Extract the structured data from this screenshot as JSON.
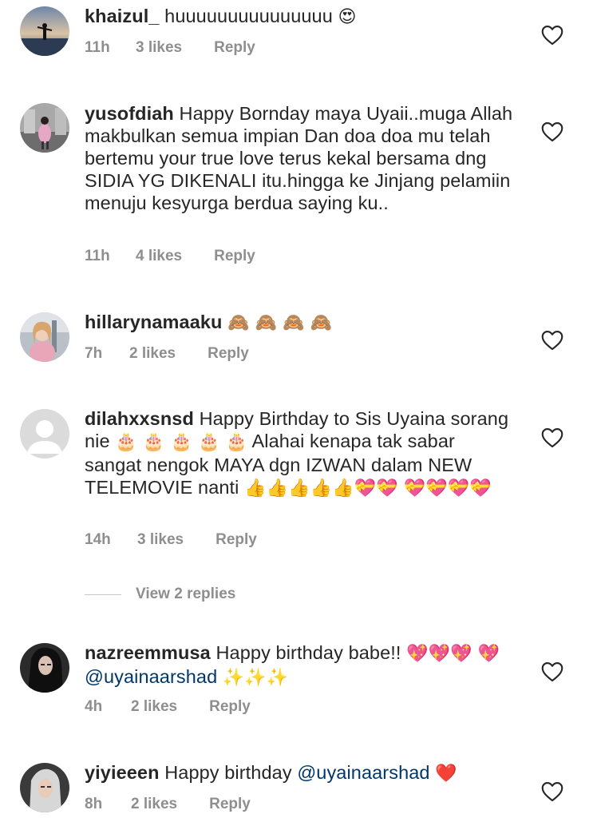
{
  "comments": [
    {
      "username": "khaizul_",
      "text": "huuuuuuuuuuuuuuu",
      "emoji": "😍",
      "time": "11h",
      "likes": "3 likes",
      "reply": "Reply"
    },
    {
      "username": "yusofdiah",
      "text": "Happy Bornday maya Uyaii..muga Allah makbulkan semua impian Dan doa doa mu telah bertemu your true love terus kekal bersama dng SIDIA YG DIKENALI itu.hingga ke Jinjang pelamiin menuju kesyurga berdua saying ku..",
      "time": "11h",
      "likes": "4 likes",
      "reply": "Reply"
    },
    {
      "username": "hillarynamaaku",
      "emoji": "🙈 🙈 🙈 🙈",
      "time": "7h",
      "likes": "2 likes",
      "reply": "Reply"
    },
    {
      "username": "dilahxxsnsd",
      "text_1": "Happy Birthday to Sis Uyaina sorang nie",
      "emoji_1": "🎂 🎂 🎂 🎂 🎂",
      "text_2": "Alahai kenapa tak sabar sangat nengok MAYA dgn IZWAN dalam NEW TELEMOVIE nanti",
      "emoji_2": "👍👍👍👍👍💝💝 💝💝💝💝",
      "time": "14h",
      "likes": "3 likes",
      "reply": "Reply",
      "view_replies": "View 2 replies"
    },
    {
      "username": "nazreemmusa",
      "text": "Happy birthday babe!!",
      "emoji_1": "💖💖💖 💖",
      "mention": "@uyainaarshad",
      "emoji_2": "✨✨✨",
      "time": "4h",
      "likes": "2 likes",
      "reply": "Reply"
    },
    {
      "username": "yiyieeen",
      "text": "Happy birthday",
      "mention": "@uyainaarshad",
      "emoji": "❤️",
      "time": "8h",
      "likes": "2 likes",
      "reply": "Reply"
    }
  ],
  "colors": {
    "text": "#262626",
    "meta": "#8e8e8e",
    "mention": "#00376b"
  },
  "icons": {
    "like": "heart-outline-icon"
  }
}
